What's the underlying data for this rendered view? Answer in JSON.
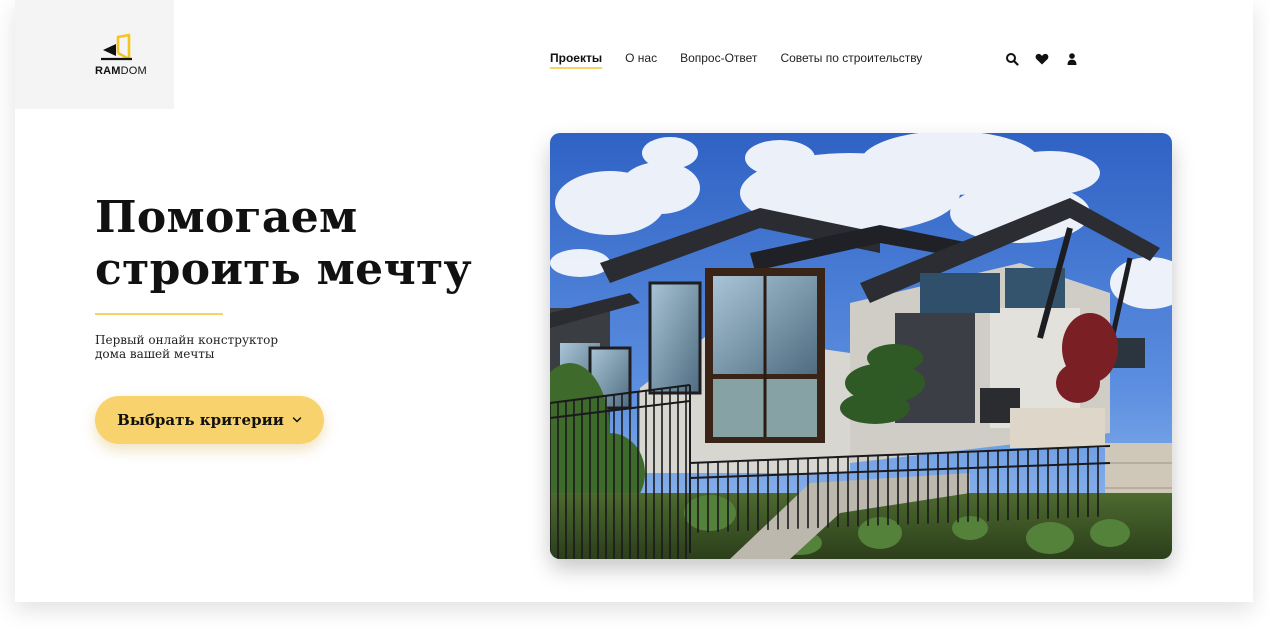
{
  "logo": {
    "text_bold": "RAM",
    "text_light": "DOM",
    "accent_color": "#f6d14a"
  },
  "nav": {
    "items": [
      {
        "label": "Проекты",
        "active": true
      },
      {
        "label": "О нас",
        "active": false
      },
      {
        "label": "Вопрос-Ответ",
        "active": false
      },
      {
        "label": "Советы по строительству",
        "active": false
      }
    ]
  },
  "header_icons": [
    "search-icon",
    "heart-icon",
    "user-icon"
  ],
  "hero": {
    "title_line1": "Помогаем",
    "title_line2": "строить мечту",
    "subtitle_line1": "Первый онлайн конструктор",
    "subtitle_line2": "дома вашей мечты",
    "cta_label": "Выбрать критерии",
    "accent_color": "#f8d26c"
  }
}
